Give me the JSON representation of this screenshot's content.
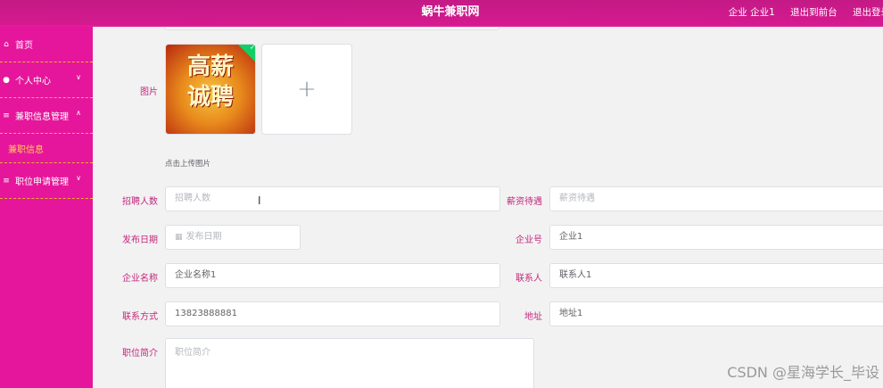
{
  "header": {
    "title": "蜗牛兼职网",
    "actions": [
      "企业 企业1",
      "退出到前台",
      "退出登录"
    ]
  },
  "sidebar": {
    "items": [
      {
        "label": "首页",
        "icon": "home-icon"
      },
      {
        "label": "个人中心",
        "icon": "user-icon"
      },
      {
        "label": "兼职信息管理",
        "icon": "list-icon"
      },
      {
        "label": "兼职信息"
      },
      {
        "label": "职位申请管理",
        "icon": "list-icon"
      }
    ]
  },
  "form": {
    "image_label": "图片",
    "upload_hint": "点击上传图片",
    "upload_plus": "+",
    "thumb_text": [
      "高薪",
      "诚聘"
    ],
    "recruit_label": "招聘人数",
    "recruit_placeholder": "招聘人数",
    "salary_label": "薪资待遇",
    "salary_placeholder": "薪资待遇",
    "date_label": "发布日期",
    "date_placeholder": "发布日期",
    "company_no_label": "企业号",
    "company_no_value": "企业1",
    "company_name_label": "企业名称",
    "company_name_value": "企业名称1",
    "contact_label": "联系人",
    "contact_value": "联系人1",
    "phone_label": "联系方式",
    "phone_value": "13823888881",
    "address_label": "地址",
    "address_value": "地址1",
    "intro_label": "职位简介",
    "intro_placeholder": "职位简介"
  },
  "watermark": "CSDN @星海学长_毕设"
}
